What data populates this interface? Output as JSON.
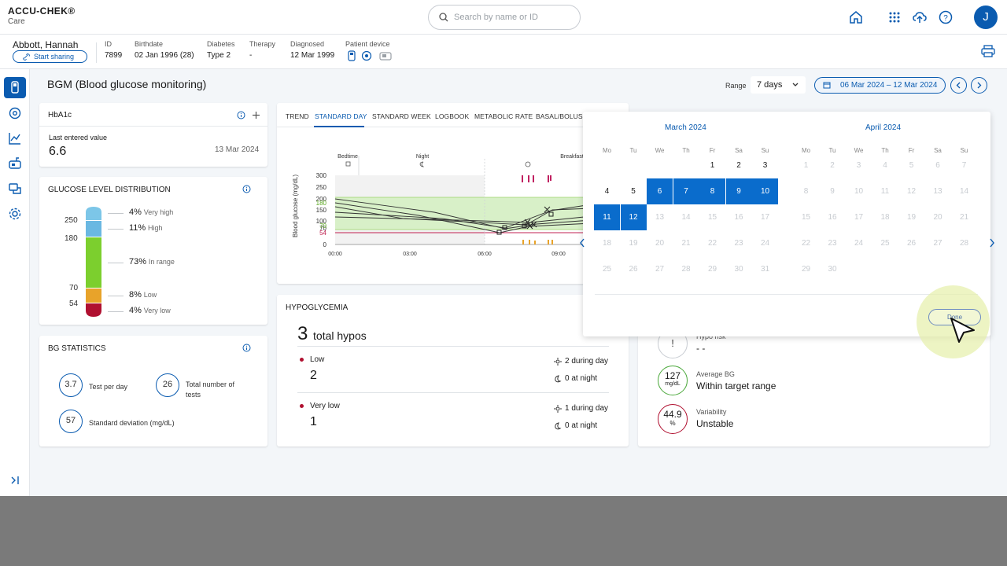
{
  "colors": {
    "brand": "#0a5bb0",
    "very_high": "#7cc6e8",
    "high": "#6ab8e2",
    "in_range": "#7ccf2e",
    "low": "#e8a32a",
    "very_low": "#b01030"
  },
  "header": {
    "logo": "ACCU-CHEK®",
    "logo_sub": "Care",
    "search_placeholder": "Search by name or ID",
    "avatar_initial": "J",
    "icons": [
      "home-icon",
      "apps-grid-icon",
      "upload-cloud-icon",
      "help-icon"
    ]
  },
  "patient": {
    "name": "Abbott, Hannah",
    "share_label": "Start sharing",
    "fields": [
      {
        "label": "ID",
        "value": "7899"
      },
      {
        "label": "Birthdate",
        "value": "02 Jan 1996 (28)"
      },
      {
        "label": "Diabetes",
        "value": "Type 2"
      },
      {
        "label": "Therapy",
        "value": "-"
      },
      {
        "label": "Diagnosed",
        "value": "12 Mar 1999"
      }
    ],
    "device_label": "Patient device"
  },
  "page": {
    "title": "BGM (Blood glucose monitoring)",
    "range_label": "Range",
    "range_value": "7 days",
    "date_range": "06 Mar 2024 – 12 Mar 2024"
  },
  "hba1c": {
    "title": "HbA1c",
    "last_label": "Last entered value",
    "value": "6.6",
    "date": "13 Mar 2024"
  },
  "glucose_distribution": {
    "title": "GLUCOSE LEVEL DISTRIBUTION",
    "thresholds": [
      "250",
      "180",
      "70",
      "54"
    ],
    "bands": [
      {
        "pct": "4%",
        "label": "Very high",
        "fraction": 0.04
      },
      {
        "pct": "11%",
        "label": "High",
        "fraction": 0.11
      },
      {
        "pct": "73%",
        "label": "In range",
        "fraction": 0.73
      },
      {
        "pct": "8%",
        "label": "Low",
        "fraction": 0.08
      },
      {
        "pct": "4%",
        "label": "Very low",
        "fraction": 0.04
      }
    ]
  },
  "bg_stats": {
    "title": "BG STATISTICS",
    "tests_per_day": {
      "value": "3.7",
      "label": "Test per day"
    },
    "total_tests": {
      "value": "26",
      "label": "Total number of tests"
    },
    "std_dev": {
      "value": "57",
      "label": "Standard deviation (mg/dL)"
    }
  },
  "chart_tabs": [
    "TREND",
    "STANDARD DAY",
    "STANDARD WEEK",
    "LOGBOOK",
    "METABOLIC RATE",
    "BASAL/BOLUS I"
  ],
  "chart_data": {
    "type": "line",
    "ylabel": "Blood glucose (mg/dL)",
    "y_ticks": [
      "300",
      "250",
      "200",
      "150",
      "100",
      "70",
      "54",
      "0"
    ],
    "target_ticks": [
      "180",
      "70"
    ],
    "x_ticks": [
      "00:00",
      "03:00",
      "06:00",
      "09:00"
    ],
    "markers": [
      "Bedtime",
      "Night",
      "Breakfast"
    ],
    "ylim": [
      0,
      300
    ]
  },
  "hypoglycemia": {
    "title": "HYPOGLYCEMIA",
    "total": "3",
    "total_label": "total hypos",
    "rows": [
      {
        "label": "Low",
        "count": "2",
        "day": "2 during day",
        "night": "0 at night"
      },
      {
        "label": "Very low",
        "count": "1",
        "day": "1 during day",
        "night": "0 at night"
      }
    ]
  },
  "risk": {
    "hypo_label": "Hypo risk",
    "hypo_value": "- -",
    "avg_value": "127",
    "avg_unit": "mg/dL",
    "avg_label": "Average BG",
    "avg_status": "Within target range",
    "var_value": "44.9",
    "var_unit": "%",
    "var_label": "Variability",
    "var_status": "Unstable"
  },
  "calendar": {
    "month1": "March 2024",
    "month2": "April 2024",
    "weekdays": [
      "Mo",
      "Tu",
      "We",
      "Th",
      "Fr",
      "Sa",
      "Su"
    ],
    "done_label": "Done"
  }
}
